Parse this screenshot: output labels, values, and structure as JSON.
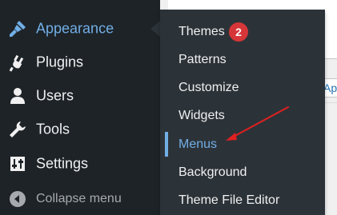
{
  "admin_menu": {
    "items": [
      {
        "label": "Appearance",
        "icon": "paintbrush-icon",
        "active": true
      },
      {
        "label": "Plugins",
        "icon": "plugin-icon"
      },
      {
        "label": "Users",
        "icon": "user-icon"
      },
      {
        "label": "Tools",
        "icon": "wrench-icon"
      },
      {
        "label": "Settings",
        "icon": "settings-sliders-icon"
      }
    ],
    "collapse_label": "Collapse menu",
    "collapse_icon": "collapse-arrow-icon"
  },
  "submenu": {
    "items": [
      {
        "label": "Themes",
        "badge": "2"
      },
      {
        "label": "Patterns"
      },
      {
        "label": "Customize"
      },
      {
        "label": "Widgets"
      },
      {
        "label": "Menus",
        "current": true
      },
      {
        "label": "Background"
      },
      {
        "label": "Theme File Editor"
      }
    ]
  },
  "content": {
    "link_fragment": "Ap"
  },
  "colors": {
    "sidebar_bg": "#1d2327",
    "flyout_bg": "#2c3338",
    "accent": "#72aee6",
    "badge_bg": "#d63638",
    "annotation_arrow": "#e02020"
  }
}
